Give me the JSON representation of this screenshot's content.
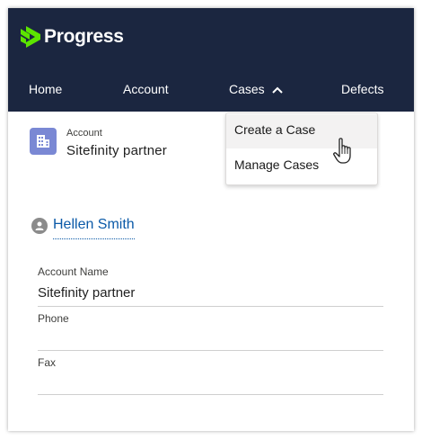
{
  "brand": {
    "name": "Progress",
    "icon": "progress-logo-icon",
    "accent": "#5ce500"
  },
  "colors": {
    "header_bg": "#1b2640",
    "link": "#0b5aa8",
    "account_icon_bg": "#7a88d4"
  },
  "nav": {
    "home": "Home",
    "account": "Account",
    "cases": "Cases",
    "defects": "Defects",
    "cases_icon": "chevron-up-icon"
  },
  "dropdown": {
    "items": [
      {
        "label": "Create a Case",
        "hovered": true
      },
      {
        "label": "Manage Cases",
        "hovered": false
      }
    ]
  },
  "account": {
    "label": "Account",
    "name": "Sitefinity partner",
    "icon": "building-icon"
  },
  "contact": {
    "name": "Hellen Smith",
    "icon": "user-icon"
  },
  "fields": {
    "account_name_label": "Account Name",
    "account_name_value": "Sitefinity partner",
    "phone_label": "Phone",
    "phone_value": "",
    "fax_label": "Fax",
    "fax_value": ""
  }
}
